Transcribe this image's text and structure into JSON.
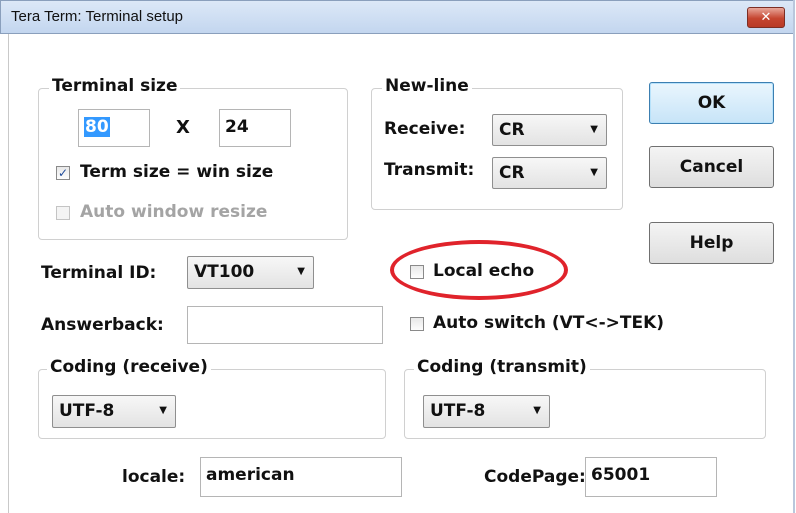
{
  "window": {
    "title": "Tera Term: Terminal setup",
    "close_glyph": "✕"
  },
  "terminal_size": {
    "legend": "Terminal size",
    "columns": "80",
    "times": "X",
    "rows": "24",
    "term_size_eq_win_size": {
      "label": "Term size = win size",
      "checked": true
    },
    "auto_window_resize": {
      "label": "Auto window resize",
      "checked": false,
      "disabled": true
    }
  },
  "new_line": {
    "legend": "New-line",
    "receive_label": "Receive:",
    "receive_value": "CR",
    "transmit_label": "Transmit:",
    "transmit_value": "CR"
  },
  "buttons": {
    "ok": "OK",
    "cancel": "Cancel",
    "help": "Help"
  },
  "terminal_id": {
    "label": "Terminal ID:",
    "value": "VT100"
  },
  "local_echo": {
    "label": "Local echo",
    "checked": false
  },
  "answerback": {
    "label": "Answerback:",
    "value": ""
  },
  "auto_switch": {
    "label": "Auto switch (VT<->TEK)",
    "checked": false
  },
  "coding_receive": {
    "legend": "Coding (receive)",
    "value": "UTF-8"
  },
  "coding_transmit": {
    "legend": "Coding (transmit)",
    "value": "UTF-8"
  },
  "locale": {
    "label": "locale:",
    "value": "american"
  },
  "codepage": {
    "label": "CodePage:",
    "value": "65001"
  },
  "icons": {
    "checkmark": "✓",
    "dropdown_arrow": "▼",
    "highlight": "red-ellipse-annotation"
  },
  "colors": {
    "highlight": "#e0232b",
    "selection": "#3399ff",
    "titlebar": "#c3d6ef"
  }
}
